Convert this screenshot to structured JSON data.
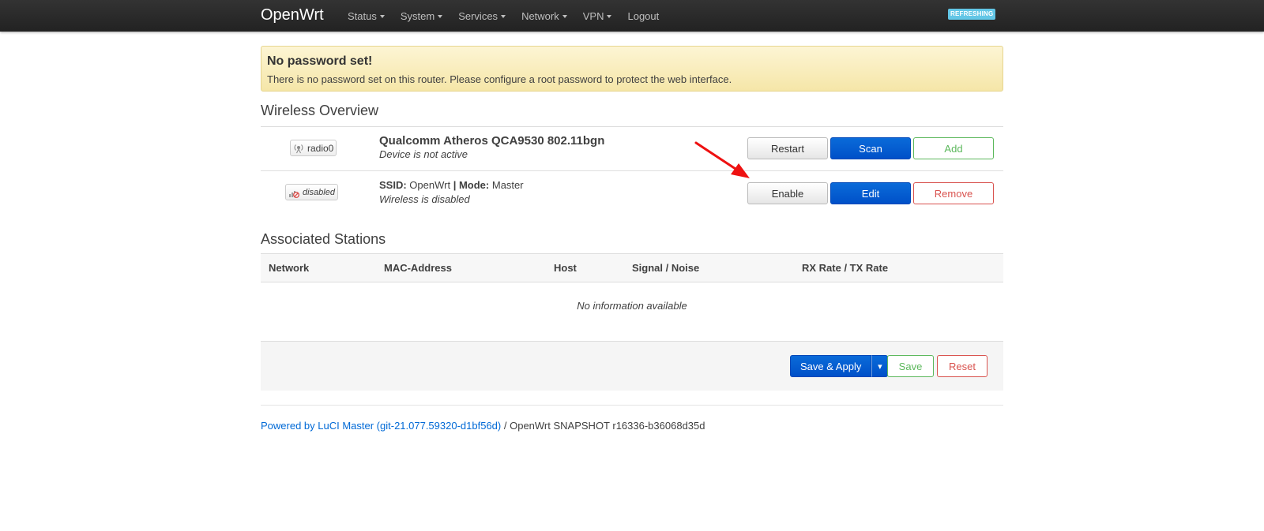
{
  "navbar": {
    "brand": "OpenWrt",
    "menu": [
      {
        "label": "Status",
        "dropdown": true
      },
      {
        "label": "System",
        "dropdown": true
      },
      {
        "label": "Services",
        "dropdown": true
      },
      {
        "label": "Network",
        "dropdown": true
      },
      {
        "label": "VPN",
        "dropdown": true
      },
      {
        "label": "Logout",
        "dropdown": false
      }
    ],
    "badge": "REFRESHING"
  },
  "alert": {
    "title": "No password set!",
    "message": "There is no password set on this router. Please configure a root password to protect the web interface."
  },
  "wireless": {
    "title": "Wireless Overview",
    "radio": {
      "badge_label": "radio0",
      "badge_icon": "wifi-antenna-icon",
      "name": "Qualcomm Atheros QCA9530 802.11bgn",
      "status": "Device is not active",
      "buttons": {
        "restart": "Restart",
        "scan": "Scan",
        "add": "Add"
      }
    },
    "network": {
      "badge_label": "disabled",
      "badge_icon": "signal-disabled-icon",
      "ssid_label": "SSID:",
      "ssid_value": "OpenWrt",
      "separator": "|",
      "mode_label": "Mode:",
      "mode_value": "Master",
      "status": "Wireless is disabled",
      "buttons": {
        "enable": "Enable",
        "edit": "Edit",
        "remove": "Remove"
      }
    }
  },
  "stations": {
    "title": "Associated Stations",
    "columns": [
      "Network",
      "MAC-Address",
      "Host",
      "Signal / Noise",
      "RX Rate / TX Rate"
    ],
    "empty": "No information available"
  },
  "actions": {
    "save_apply": "Save & Apply",
    "toggle": "▾",
    "save": "Save",
    "reset": "Reset"
  },
  "footer": {
    "link": "Powered by LuCI Master (git-21.077.59320-d1bf56d)",
    "text": "/ OpenWrt SNAPSHOT r16336-b36068d35d"
  },
  "colors": {
    "primary": "#0050c8",
    "positive": "#5cb85c",
    "negative": "#d9534f",
    "alert_bg": "#f5e6a8",
    "badge": "#62c6e6",
    "annotation_arrow": "#ee1111"
  }
}
